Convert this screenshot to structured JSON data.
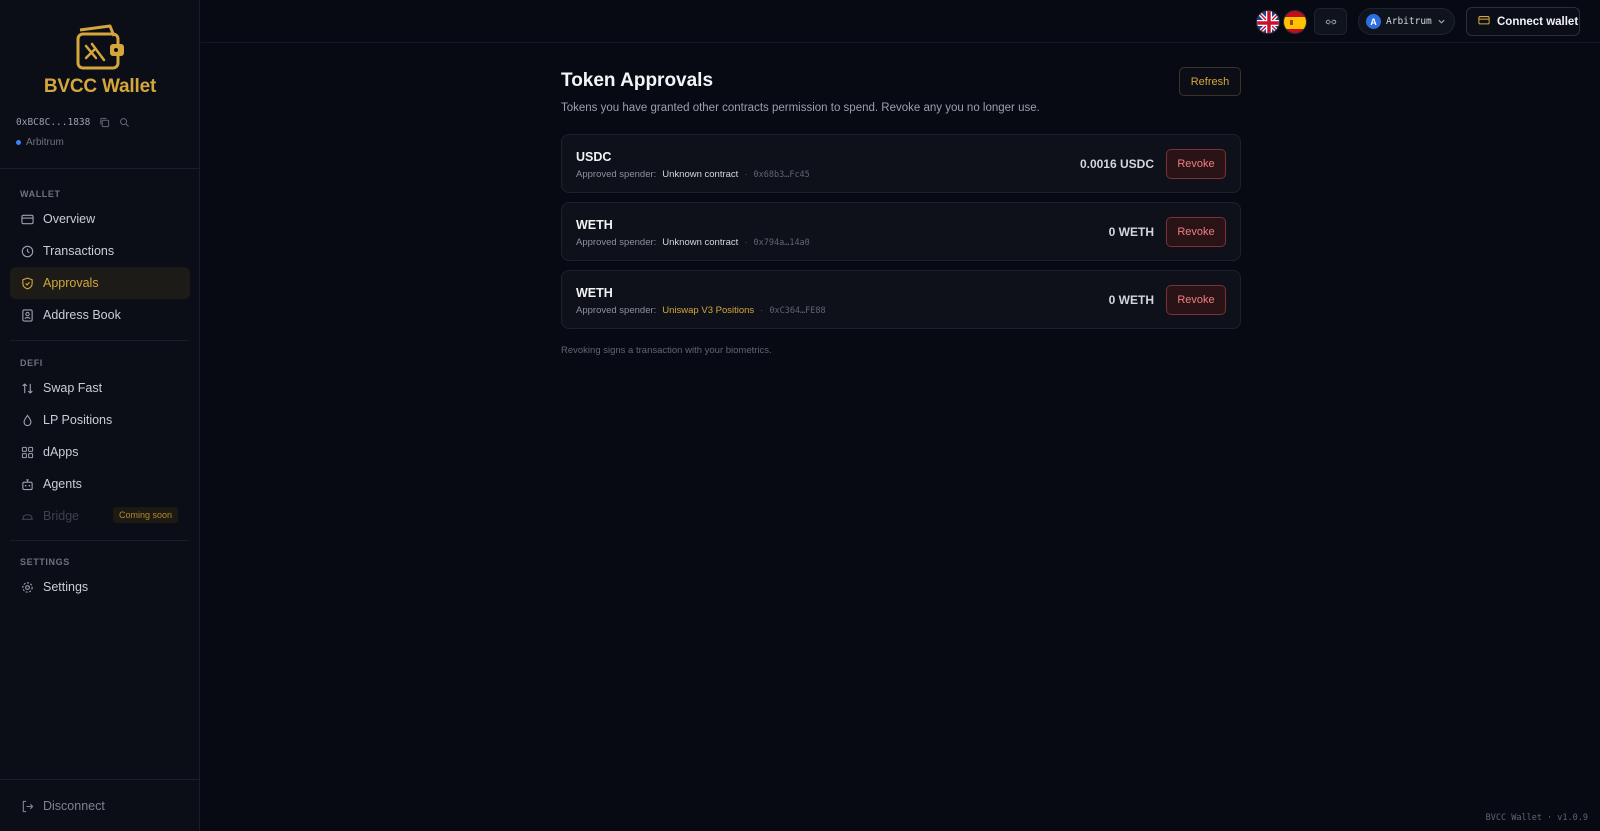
{
  "brand": {
    "name": "BVCC Wallet",
    "logo_icon": "wallet-logo-icon"
  },
  "account": {
    "address": "0xBC8C...1838",
    "network": "Arbitrum"
  },
  "sidebar": {
    "sections": {
      "wallet": "WALLET",
      "defi": "DEFI",
      "settings": "SETTINGS"
    },
    "items": [
      {
        "label": "Overview",
        "icon": "card-icon"
      },
      {
        "label": "Transactions",
        "icon": "clock-icon"
      },
      {
        "label": "Approvals",
        "icon": "shield-icon",
        "active": true
      },
      {
        "label": "Address Book",
        "icon": "contact-book-icon"
      },
      {
        "label": "Swap Fast",
        "icon": "swap-arrows-icon"
      },
      {
        "label": "LP Positions",
        "icon": "droplet-icon"
      },
      {
        "label": "dApps",
        "icon": "grid-icon"
      },
      {
        "label": "Agents",
        "icon": "bot-icon"
      },
      {
        "label": "Bridge",
        "icon": "bridge-icon",
        "disabled": true,
        "badge": "Coming soon"
      },
      {
        "label": "Settings",
        "icon": "gear-icon"
      }
    ],
    "disconnect": "Disconnect"
  },
  "topbar": {
    "languages": [
      "English",
      "Español"
    ],
    "network_select": "Arbitrum",
    "connect": "Connect wallet"
  },
  "main": {
    "title": "Token Approvals",
    "subtitle": "Tokens you have granted other contracts permission to spend. Revoke any you no longer use.",
    "refresh": "Refresh",
    "spender_prefix": "Approved spender:",
    "approvals": [
      {
        "token": "USDC",
        "spender": "Unknown contract",
        "contract": "0x68b3…Fc45",
        "amount": "0.0016 USDC",
        "action": "Revoke"
      },
      {
        "token": "WETH",
        "spender": "Unknown contract",
        "contract": "0x794a…14a0",
        "amount": "0 WETH",
        "action": "Revoke"
      },
      {
        "token": "WETH",
        "spender": "Uniswap V3 Positions",
        "contract": "0xC364…FE88",
        "amount": "0 WETH",
        "action": "Revoke"
      }
    ],
    "footnote": "Revoking signs a transaction with your biometrics."
  },
  "footer": {
    "version": "BVCC Wallet · v1.0.9"
  },
  "colors": {
    "accent": "#d4a63c",
    "danger": "#f07d82",
    "background": "#070a12",
    "network": "#3b82f6"
  }
}
